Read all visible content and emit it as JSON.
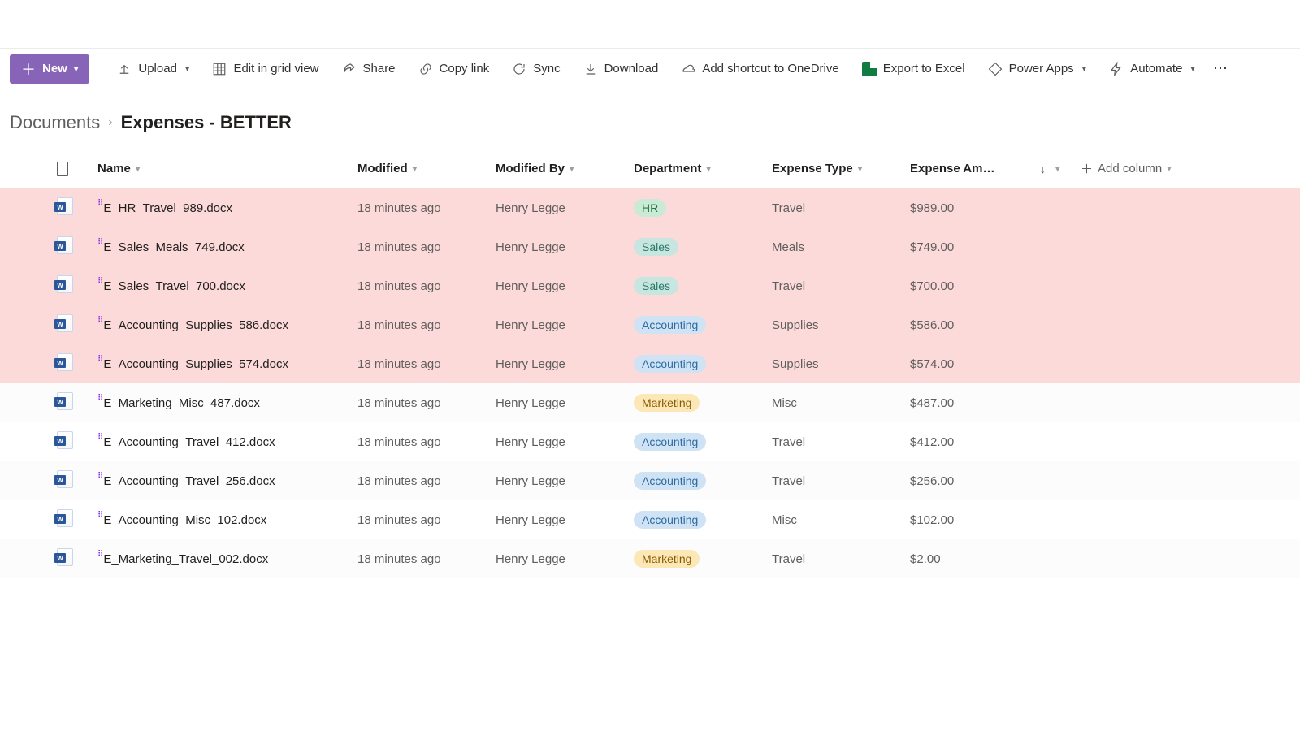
{
  "toolbar": {
    "new": "New",
    "upload": "Upload",
    "edit_grid": "Edit in grid view",
    "share": "Share",
    "copy_link": "Copy link",
    "sync": "Sync",
    "download": "Download",
    "add_shortcut": "Add shortcut to OneDrive",
    "export_excel": "Export to Excel",
    "power_apps": "Power Apps",
    "automate": "Automate"
  },
  "breadcrumb": {
    "root": "Documents",
    "current": "Expenses - BETTER"
  },
  "columns": {
    "name": "Name",
    "modified": "Modified",
    "modified_by": "Modified By",
    "department": "Department",
    "expense_type": "Expense Type",
    "expense_amount": "Expense Am…",
    "add_column": "Add column"
  },
  "rows": [
    {
      "name": "E_HR_Travel_989.docx",
      "modified": "18 minutes ago",
      "by": "Henry Legge",
      "dept": "HR",
      "type": "Travel",
      "amount": "$989.00",
      "hl": true
    },
    {
      "name": "E_Sales_Meals_749.docx",
      "modified": "18 minutes ago",
      "by": "Henry Legge",
      "dept": "Sales",
      "type": "Meals",
      "amount": "$749.00",
      "hl": true
    },
    {
      "name": "E_Sales_Travel_700.docx",
      "modified": "18 minutes ago",
      "by": "Henry Legge",
      "dept": "Sales",
      "type": "Travel",
      "amount": "$700.00",
      "hl": true
    },
    {
      "name": "E_Accounting_Supplies_586.docx",
      "modified": "18 minutes ago",
      "by": "Henry Legge",
      "dept": "Accounting",
      "type": "Supplies",
      "amount": "$586.00",
      "hl": true
    },
    {
      "name": "E_Accounting_Supplies_574.docx",
      "modified": "18 minutes ago",
      "by": "Henry Legge",
      "dept": "Accounting",
      "type": "Supplies",
      "amount": "$574.00",
      "hl": true
    },
    {
      "name": "E_Marketing_Misc_487.docx",
      "modified": "18 minutes ago",
      "by": "Henry Legge",
      "dept": "Marketing",
      "type": "Misc",
      "amount": "$487.00",
      "hl": false
    },
    {
      "name": "E_Accounting_Travel_412.docx",
      "modified": "18 minutes ago",
      "by": "Henry Legge",
      "dept": "Accounting",
      "type": "Travel",
      "amount": "$412.00",
      "hl": false
    },
    {
      "name": "E_Accounting_Travel_256.docx",
      "modified": "18 minutes ago",
      "by": "Henry Legge",
      "dept": "Accounting",
      "type": "Travel",
      "amount": "$256.00",
      "hl": false
    },
    {
      "name": "E_Accounting_Misc_102.docx",
      "modified": "18 minutes ago",
      "by": "Henry Legge",
      "dept": "Accounting",
      "type": "Misc",
      "amount": "$102.00",
      "hl": false
    },
    {
      "name": "E_Marketing_Travel_002.docx",
      "modified": "18 minutes ago",
      "by": "Henry Legge",
      "dept": "Marketing",
      "type": "Travel",
      "amount": "$2.00",
      "hl": false
    }
  ]
}
